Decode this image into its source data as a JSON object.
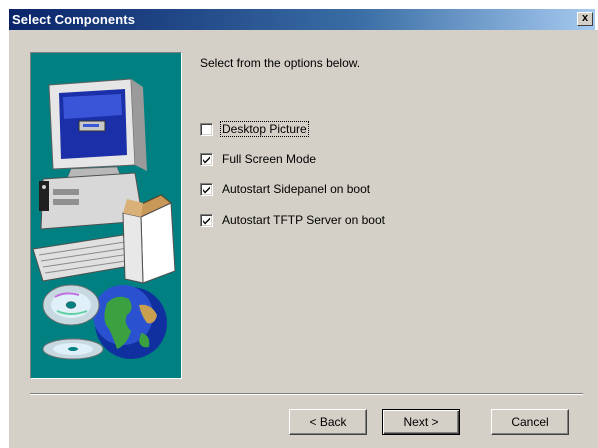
{
  "window": {
    "title": "Select Components",
    "close_label": "x"
  },
  "prompt": "Select from the options below.",
  "options": [
    {
      "label": "Desktop Picture",
      "checked": false,
      "focused": true
    },
    {
      "label": "Full Screen Mode",
      "checked": true,
      "focused": false
    },
    {
      "label": "Autostart Sidepanel on boot",
      "checked": true,
      "focused": false
    },
    {
      "label": "Autostart TFTP Server on boot",
      "checked": true,
      "focused": false
    }
  ],
  "buttons": {
    "back_label": "< Back",
    "next_label": "Next >",
    "cancel_label": "Cancel"
  },
  "colors": {
    "titlebar_start": "#0a246a",
    "titlebar_end": "#a6caf0",
    "face": "#d4d0c8",
    "side_panel": "#008080"
  },
  "icons": {
    "side_panel_art": "computer-with-globe-and-cds-icon",
    "checkmark": "checkmark-icon"
  }
}
